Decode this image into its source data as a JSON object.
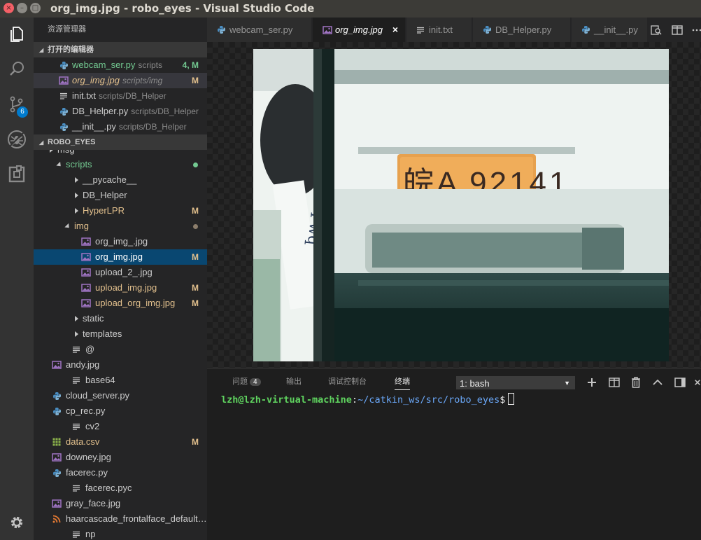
{
  "window": {
    "title": "org_img.jpg - robo_eyes - Visual Studio Code",
    "buttons": {
      "close": "×",
      "minimize": "–",
      "maximize": "□"
    }
  },
  "activity_bar": {
    "items": [
      {
        "name": "explorer",
        "icon": "files-icon"
      },
      {
        "name": "search",
        "icon": "search-icon"
      },
      {
        "name": "source-control",
        "icon": "git-branch-icon",
        "badge": "6"
      },
      {
        "name": "debug",
        "icon": "debug-icon"
      },
      {
        "name": "extensions",
        "icon": "extensions-icon"
      }
    ],
    "settings_icon": "gear-icon"
  },
  "sidebar": {
    "title": "资源管理器",
    "open_editors": {
      "header": "打开的编辑器",
      "items": [
        {
          "label": "webcam_ser.py",
          "desc": "scripts",
          "deco": "4, M",
          "icon": "python-icon",
          "color": "#73c991"
        },
        {
          "label": "org_img.jpg",
          "desc": "scripts/img",
          "deco": "M",
          "icon": "image-icon",
          "color": "#e2c08d",
          "italic": true
        },
        {
          "label": "init.txt",
          "desc": "scripts/DB_Helper",
          "deco": "",
          "icon": "text-file-icon",
          "color": "#cccccc"
        },
        {
          "label": "DB_Helper.py",
          "desc": "scripts/DB_Helper",
          "deco": "",
          "icon": "python-icon",
          "color": "#cccccc"
        },
        {
          "label": "__init__.py",
          "desc": "scripts/DB_Helper",
          "deco": "",
          "icon": "python-icon",
          "color": "#cccccc"
        }
      ]
    },
    "project": {
      "header": "ROBO_EYES",
      "partial_item": "msg",
      "tree": [
        {
          "label": "scripts",
          "indent": 1,
          "type": "folder-open",
          "color": "#73c991",
          "dot": "#73c991"
        },
        {
          "label": "__pycache__",
          "indent": 2,
          "type": "folder",
          "color": "#cccccc"
        },
        {
          "label": "DB_Helper",
          "indent": 2,
          "type": "folder",
          "color": "#cccccc"
        },
        {
          "label": "HyperLPR",
          "indent": 2,
          "type": "folder",
          "color": "#e2c08d",
          "deco": "M"
        },
        {
          "label": "img",
          "indent": 2,
          "type": "folder-open",
          "color": "#e2c08d",
          "dot": "#8b7d6b"
        },
        {
          "label": "org_img_.jpg",
          "indent": 3,
          "type": "image",
          "color": "#cccccc"
        },
        {
          "label": "org_img.jpg",
          "indent": 3,
          "type": "image",
          "color": "#ffffff",
          "deco": "M",
          "selected": true
        },
        {
          "label": "upload_2_.jpg",
          "indent": 3,
          "type": "image",
          "color": "#cccccc"
        },
        {
          "label": "upload_img.jpg",
          "indent": 3,
          "type": "image",
          "color": "#e2c08d",
          "deco": "M"
        },
        {
          "label": "upload_org_img.jpg",
          "indent": 3,
          "type": "image",
          "color": "#e2c08d",
          "deco": "M"
        },
        {
          "label": "static",
          "indent": 2,
          "type": "folder",
          "color": "#cccccc"
        },
        {
          "label": "templates",
          "indent": 2,
          "type": "folder",
          "color": "#cccccc"
        },
        {
          "label": "@",
          "indent": 2,
          "type": "text",
          "color": "#cccccc"
        },
        {
          "label": "andy.jpg",
          "indent": 1.5,
          "type": "image",
          "color": "#cccccc"
        },
        {
          "label": "base64",
          "indent": 2,
          "type": "text",
          "color": "#cccccc"
        },
        {
          "label": "cloud_server.py",
          "indent": 1.5,
          "type": "python",
          "color": "#cccccc"
        },
        {
          "label": "cp_rec.py",
          "indent": 1.5,
          "type": "python",
          "color": "#cccccc"
        },
        {
          "label": "cv2",
          "indent": 2,
          "type": "text",
          "color": "#cccccc"
        },
        {
          "label": "data.csv",
          "indent": 1.5,
          "type": "csv",
          "color": "#e2c08d",
          "deco": "M"
        },
        {
          "label": "downey.jpg",
          "indent": 1.5,
          "type": "image",
          "color": "#cccccc"
        },
        {
          "label": "facerec.py",
          "indent": 1.5,
          "type": "python",
          "color": "#cccccc"
        },
        {
          "label": "facerec.pyc",
          "indent": 2,
          "type": "text",
          "color": "#cccccc"
        },
        {
          "label": "gray_face.jpg",
          "indent": 1.5,
          "type": "image",
          "color": "#cccccc"
        },
        {
          "label": "haarcascade_frontalface_default…",
          "indent": 1.5,
          "type": "rss",
          "color": "#cccccc"
        },
        {
          "label": "np",
          "indent": 2,
          "type": "text",
          "color": "#cccccc"
        }
      ]
    }
  },
  "tabs": [
    {
      "label": "webcam_ser.py",
      "icon": "python-icon"
    },
    {
      "label": "org_img.jpg",
      "icon": "image-icon",
      "active": true,
      "close": "×"
    },
    {
      "label": "init.txt",
      "icon": "text-file-icon"
    },
    {
      "label": "DB_Helper.py",
      "icon": "python-icon"
    },
    {
      "label": "__init__.py",
      "icon": "python-icon"
    }
  ],
  "editor_actions": [
    "open-preview-icon",
    "split-editor-icon",
    "more-icon"
  ],
  "image": {
    "plate_text": "皖A 92141"
  },
  "panel": {
    "tabs": [
      {
        "label": "问题",
        "badge": "4"
      },
      {
        "label": "输出"
      },
      {
        "label": "调试控制台"
      },
      {
        "label": "终端",
        "active": true
      }
    ],
    "terminal_select": "1: bash",
    "actions": [
      "plus-icon",
      "split-icon",
      "trash-icon",
      "chevron-up-icon",
      "panel-layout-icon",
      "close-icon"
    ],
    "prompt": {
      "user": "lzh@lzh-virtual-machine",
      "sep": ":",
      "path": "~/catkin_ws/src/robo_eyes",
      "dollar": "$"
    }
  },
  "colors": {
    "accent": "#007acc",
    "modified": "#e2c08d",
    "added": "#73c991",
    "selection": "#094771"
  }
}
